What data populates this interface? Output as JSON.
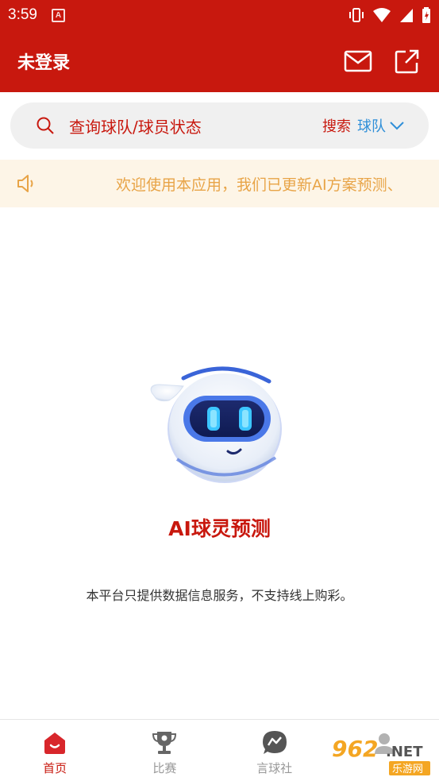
{
  "status_bar": {
    "time": "3:59",
    "notification_badge": "A",
    "icons": [
      "vibrate-icon",
      "wifi-icon",
      "signal-icon",
      "battery-icon"
    ]
  },
  "app_bar": {
    "title": "未登录",
    "actions": [
      "mail-icon",
      "share-icon"
    ]
  },
  "search": {
    "placeholder": "查询球队/球员状态",
    "action_label": "搜索",
    "type_label": "球队"
  },
  "notice": {
    "text": "欢迎使用本应用，我们已更新AI方案预测、"
  },
  "main": {
    "brand_title": "AI球灵预测",
    "disclaimer": "本平台只提供数据信息服务，不支持线上购彩。"
  },
  "tabs": [
    {
      "label": "首页",
      "icon": "home-icon",
      "active": true
    },
    {
      "label": "比赛",
      "icon": "trophy-icon",
      "active": false
    },
    {
      "label": "言球社",
      "icon": "chat-icon",
      "active": false
    },
    {
      "label": "",
      "icon": "profile-icon",
      "active": false
    }
  ],
  "watermark": {
    "text_top": "962",
    "text_suffix": ".NET",
    "text_bottom": "乐游网"
  },
  "colors": {
    "brand_red": "#c8180e",
    "accent_blue": "#2f8fd8",
    "notice_bg": "#fdf5e7",
    "notice_text": "#e8a447"
  }
}
